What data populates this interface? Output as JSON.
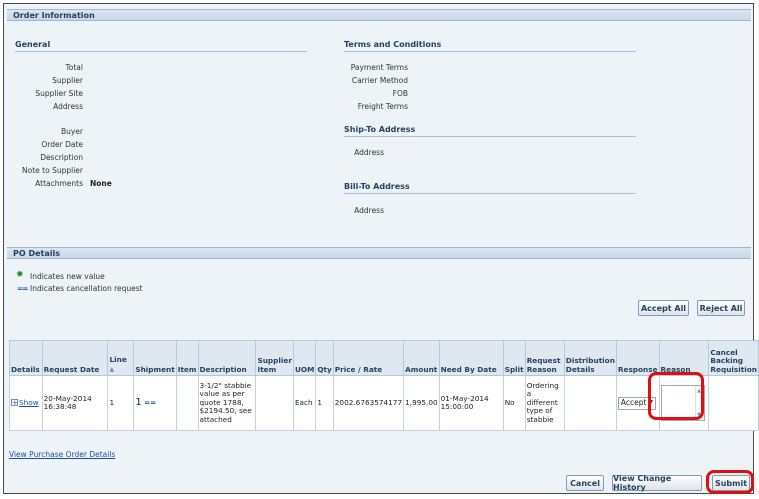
{
  "order_info": {
    "section_title": "Order Information",
    "general": {
      "heading": "General",
      "fields": [
        {
          "label": "Total",
          "value": ""
        },
        {
          "label": "Supplier",
          "value": ""
        },
        {
          "label": "Supplier Site",
          "value": ""
        },
        {
          "label": "Address",
          "value": ""
        },
        {
          "label": "Buyer",
          "value": ""
        },
        {
          "label": "Order Date",
          "value": ""
        },
        {
          "label": "Description",
          "value": ""
        },
        {
          "label": "Note to Supplier",
          "value": ""
        },
        {
          "label": "Attachments",
          "value": "None"
        }
      ]
    },
    "terms": {
      "heading": "Terms and Conditions",
      "fields": [
        {
          "label": "Payment Terms"
        },
        {
          "label": "Carrier Method"
        },
        {
          "label": "FOB"
        },
        {
          "label": "Freight Terms"
        }
      ]
    },
    "ship_to": {
      "heading": "Ship-To Address",
      "address_label": "Address"
    },
    "bill_to": {
      "heading": "Bill-To Address",
      "address_label": "Address"
    }
  },
  "po_details": {
    "section_title": "PO Details",
    "legend_new": "Indicates new value",
    "legend_cancel": "Indicates cancellation request",
    "accept_all": "Accept All",
    "reject_all": "Reject All",
    "columns": [
      "Details",
      "Request Date",
      "Line",
      "Shipment",
      "Item",
      "Description",
      "Supplier Item",
      "UOM",
      "Qty",
      "Price / Rate",
      "Amount",
      "Need By Date",
      "Split",
      "Request Reason",
      "Distribution Details",
      "Response",
      "Reason",
      "Cancel Backing Requisition"
    ],
    "sort_indicator": "▲",
    "row": {
      "details": "Show",
      "request_date": "20-May-2014 16:38:48",
      "line": "1",
      "shipment": "1",
      "shipment_marker": "==",
      "item": "",
      "description": "3-1/2\" stabbie value as per quote 1788, $2194.50, see attached",
      "supplier_item": "",
      "uom": "Each",
      "qty": "1",
      "price": "2002.6763574177",
      "amount": "1,995.00",
      "need_by": "01-May-2014 15:00:00",
      "split": "No",
      "request_reason": "Ordering a different type of stabbie",
      "distribution": "",
      "response": "Accept",
      "reason": "",
      "cancel_backing": ""
    }
  },
  "footer": {
    "view_po_link": "View Purchase Order Details",
    "cancel": "Cancel",
    "view_history": "View Change History",
    "submit": "Submit"
  },
  "accent_colors": {
    "highlight": "#e01010",
    "header": "#24425f"
  }
}
